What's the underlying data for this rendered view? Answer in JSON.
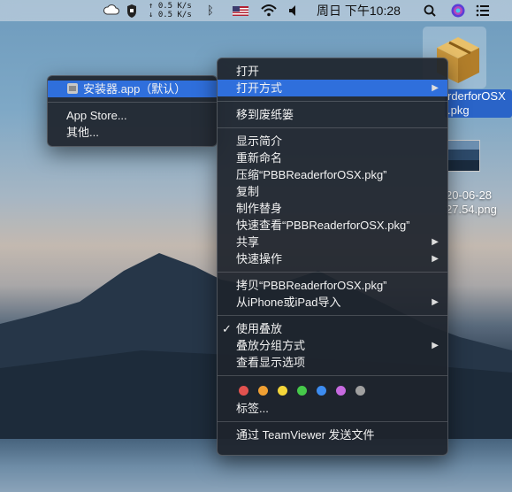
{
  "menubar": {
    "net_up": "↑ 0.5 K/s",
    "net_down": "↓ 0.5 K/s",
    "clock": "周日 下午10:28"
  },
  "desktop": {
    "pkg_name": "rderforOSX\n.pkg",
    "png_name_line1": "20-06-28",
    "png_name_line2": "27.54.png"
  },
  "submenu": {
    "items": [
      {
        "label": "安装器.app（默认）"
      },
      {
        "label": "App Store..."
      },
      {
        "label": "其他..."
      }
    ]
  },
  "context_menu": {
    "open": "打开",
    "open_with": "打开方式",
    "trash": "移到废纸篓",
    "get_info": "显示简介",
    "rename": "重新命名",
    "compress": "压缩“PBBReaderforOSX.pkg”",
    "duplicate": "复制",
    "alias": "制作替身",
    "quicklook": "快速查看“PBBReaderforOSX.pkg”",
    "share": "共享",
    "quick_actions": "快速操作",
    "copy": "拷贝“PBBReaderforOSX.pkg”",
    "import": "从iPhone或iPad导入",
    "use_stacks": "使用叠放",
    "group_stacks": "叠放分组方式",
    "view_options": "查看显示选项",
    "tags_label": "标签...",
    "teamviewer": "通过 TeamViewer 发送文件",
    "tag_colors": [
      "#e2524f",
      "#f0a033",
      "#f5d63a",
      "#46c94a",
      "#3d8cf0",
      "#c76ae0",
      "#a0a0a0"
    ]
  }
}
